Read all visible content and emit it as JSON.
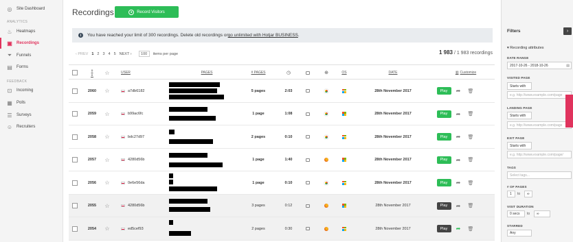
{
  "sidebar": {
    "collapse_icon": "chevron-left-icon",
    "site_dashboard": "Site Dashboard",
    "analytics_heading": "ANALYTICS",
    "analytics": [
      {
        "label": "Heatmaps",
        "icon": "flame-icon"
      },
      {
        "label": "Recordings",
        "icon": "recording-icon"
      },
      {
        "label": "Funnels",
        "icon": "funnel-icon"
      },
      {
        "label": "Forms",
        "icon": "form-icon"
      }
    ],
    "feedback_heading": "FEEDBACK",
    "feedback": [
      {
        "label": "Incoming",
        "icon": "inbox-icon"
      },
      {
        "label": "Polls",
        "icon": "poll-icon"
      },
      {
        "label": "Surveys",
        "icon": "survey-icon"
      },
      {
        "label": "Recruiters",
        "icon": "users-icon"
      }
    ]
  },
  "header": {
    "title": "Recordings",
    "record_button": "Record Visitors"
  },
  "notice": {
    "text": "You have reached your limit of 300 recordings. Delete old recordings or ",
    "link": "go unlimited with Hotjar BUSINESS",
    "end": "."
  },
  "pagination": {
    "prev": "PREV",
    "pages": [
      "1",
      "2",
      "3",
      "4",
      "5"
    ],
    "next": "NEXT",
    "per_page": "100",
    "per_page_label": "items per page"
  },
  "count": {
    "shown": "1 983",
    "total": "/ 1 983 recordings"
  },
  "table": {
    "headers": {
      "number": "#",
      "user": "USER",
      "pages": "PAGES",
      "num_pages": "# PAGES",
      "os": "OS",
      "date": "DATE",
      "customize": "Customize"
    },
    "rows": [
      {
        "id": "2060",
        "user": "a7db6182",
        "num_pages": "5 pages",
        "duration": "2:03",
        "browser": "chrome",
        "date": "28th November 2017",
        "play": "Play",
        "viewed": false
      },
      {
        "id": "2059",
        "user": "b99ac6fc",
        "num_pages": "1 page",
        "duration": "1:08",
        "browser": "chrome",
        "date": "28th November 2017",
        "play": "Play",
        "viewed": false
      },
      {
        "id": "2058",
        "user": "bdc27d97",
        "num_pages": "2 pages",
        "duration": "0:10",
        "browser": "chrome",
        "date": "28th November 2017",
        "play": "Play",
        "viewed": false
      },
      {
        "id": "2057",
        "user": "4280d56b",
        "num_pages": "1 page",
        "duration": "1:40",
        "browser": "firefox",
        "date": "28th November 2017",
        "play": "Play",
        "viewed": false
      },
      {
        "id": "2056",
        "user": "0e6e56da",
        "num_pages": "1 page",
        "duration": "0:10",
        "browser": "chrome",
        "date": "28th November 2017",
        "play": "Play",
        "viewed": false
      },
      {
        "id": "2055",
        "user": "4280d56b",
        "num_pages": "3 pages",
        "duration": "0:12",
        "browser": "firefox",
        "date": "28th November 2017",
        "play": "Play",
        "viewed": true
      },
      {
        "id": "2054",
        "user": "ed5cef93",
        "num_pages": "2 pages",
        "duration": "0:30",
        "browser": "firefox",
        "date": "28th November 2017",
        "play": "Play",
        "viewed": true
      }
    ]
  },
  "filters": {
    "title": "Filters",
    "section": "Recording attributes",
    "date_range_label": "DATE RANGE",
    "date_range_value": "2017-10-26 - 2018-10-26",
    "visited_page_label": "VISITED PAGE",
    "visited_page_op": "Starts with",
    "visited_page_ph": "e.g. http://www.example.com/page",
    "landing_page_label": "LANDING PAGE",
    "landing_page_op": "Starts with",
    "landing_page_ph": "e.g. http://www.example.com/page",
    "exit_page_label": "EXIT PAGE",
    "exit_page_op": "Starts with",
    "exit_page_ph": "e.g. http://www.example.com/page/",
    "tags_label": "TAGS",
    "tags_ph": "Select tags...",
    "num_pages_label": "# OF PAGES",
    "num_pages_from": "1",
    "to": "to",
    "num_pages_to": "∞",
    "visit_duration_label": "VISIT DURATION",
    "visit_from": "0 secs",
    "visit_to": "∞",
    "starred_label": "STARRED",
    "starred_value": "Any"
  },
  "colors": {
    "brand_green": "#2dbd57",
    "accent_red": "#e0335d"
  }
}
